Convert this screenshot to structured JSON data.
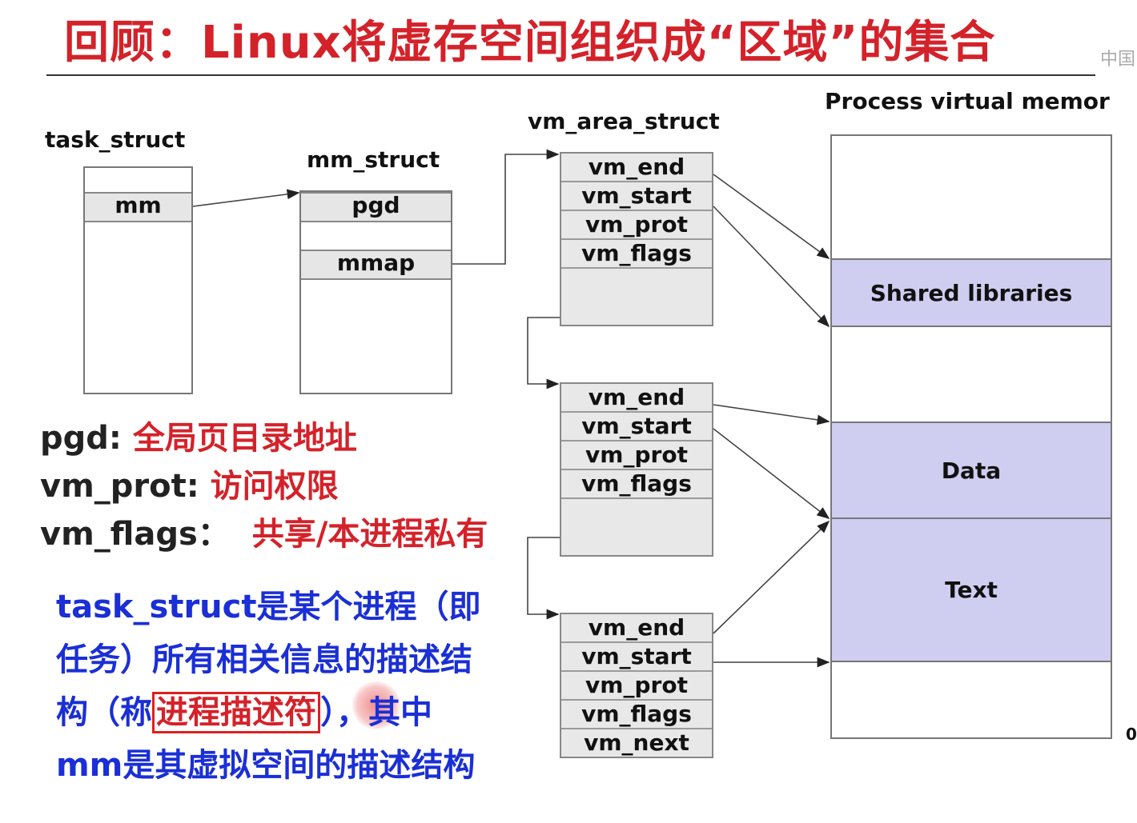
{
  "title": "回顾：Linux将虚存空间组织成“区域”的集合",
  "corner_logo": "中国",
  "task_struct": {
    "label": "task_struct",
    "field": "mm"
  },
  "mm_struct": {
    "label": "mm_struct",
    "fields": [
      "pgd",
      "mmap"
    ]
  },
  "vm_area_struct": {
    "label": "vm_area_struct",
    "areas": [
      {
        "fields": [
          "vm_end",
          "vm_start",
          "vm_prot",
          "vm_flags"
        ]
      },
      {
        "fields": [
          "vm_end",
          "vm_start",
          "vm_prot",
          "vm_flags"
        ]
      },
      {
        "fields": [
          "vm_end",
          "vm_start",
          "vm_prot",
          "vm_flags",
          "vm_next"
        ]
      }
    ]
  },
  "memory": {
    "label": "Process virtual memor",
    "segments": [
      "Shared libraries",
      "Data",
      "Text"
    ],
    "zero_label": "0"
  },
  "legend": [
    {
      "key": "pgd:",
      "value": "全局页目录地址"
    },
    {
      "key": "vm_prot:",
      "value": "访问权限"
    },
    {
      "key": "vm_flags：",
      "value": "共享/本进程私有"
    }
  ],
  "description": {
    "line1": "task_struct是某个进程（即",
    "line2": "任务）所有相关信息的描述结",
    "line3_pre": "构（称",
    "line3_highlight": "进程描述符",
    "line3_post": "），其中",
    "line4": "mm是其虚拟空间的描述结构"
  }
}
